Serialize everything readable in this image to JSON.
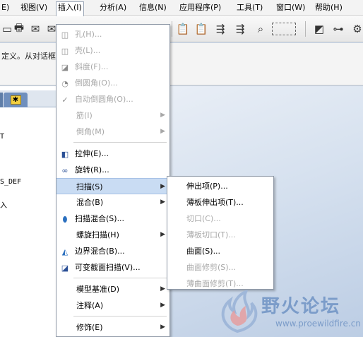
{
  "menubar": {
    "items": [
      {
        "label": "E)"
      },
      {
        "label": "视图(V)"
      },
      {
        "label": "插入(I)"
      },
      {
        "label": "分析(A)"
      },
      {
        "label": "信息(N)"
      },
      {
        "label": "应用程序(P)"
      },
      {
        "label": "工具(T)"
      },
      {
        "label": "窗口(W)"
      },
      {
        "label": "帮助(H)"
      }
    ]
  },
  "message": {
    "text": "定义。从对话框"
  },
  "model_tree": {
    "fragments": [
      "T",
      "S_DEF",
      "入"
    ]
  },
  "insert_menu": {
    "items": [
      {
        "label": "孔(H)..."
      },
      {
        "label": "壳(L)..."
      },
      {
        "label": "斜度(F)..."
      },
      {
        "label": "倒圆角(O)..."
      },
      {
        "label": "自动倒圆角(O)..."
      },
      {
        "label": "筋(I)"
      },
      {
        "label": "倒角(M)"
      },
      {
        "label": "拉伸(E)..."
      },
      {
        "label": "旋转(R)..."
      },
      {
        "label": "扫描(S)"
      },
      {
        "label": "混合(B)"
      },
      {
        "label": "扫描混合(S)..."
      },
      {
        "label": "螺旋扫描(H)"
      },
      {
        "label": "边界混合(B)..."
      },
      {
        "label": "可变截面扫描(V)..."
      },
      {
        "label": "模型基准(D)"
      },
      {
        "label": "注释(A)"
      },
      {
        "label": "修饰(E)"
      }
    ]
  },
  "sweep_submenu": {
    "items": [
      {
        "label": "伸出项(P)..."
      },
      {
        "label": "薄板伸出项(T)..."
      },
      {
        "label": "切口(C)..."
      },
      {
        "label": "薄板切口(T)..."
      },
      {
        "label": "曲面(S)..."
      },
      {
        "label": "曲面修剪(S)..."
      },
      {
        "label": "薄曲面修剪(T)..."
      }
    ]
  },
  "watermark": {
    "text": "野火论坛",
    "url": "www.proewildfire.cn"
  },
  "colors": {
    "highlight": "#c9dcf3",
    "disabled_text": "#a8a8a8",
    "watermark": "#7b9cc9"
  }
}
